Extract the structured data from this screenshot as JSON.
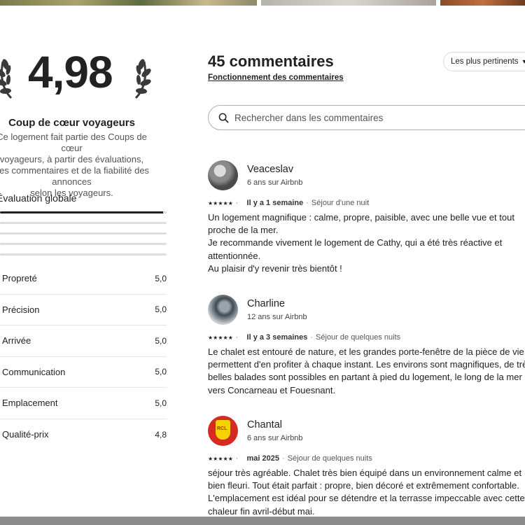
{
  "rating": {
    "value": "4,98",
    "favorite_title": "Coup de cœur voyageurs",
    "favorite_desc": "Ce logement fait partie des Coups de cœur\nvoyageurs, à partir des évaluations,\ndes commentaires et de la fiabilité des annonces\nselon les voyageurs."
  },
  "overall": {
    "label": "Évaluation globale",
    "distribution": [
      {
        "stars": 5,
        "fraction": 0.98
      },
      {
        "stars": 4,
        "fraction": 0.0
      },
      {
        "stars": 3,
        "fraction": 0.0
      },
      {
        "stars": 2,
        "fraction": 0.0
      },
      {
        "stars": 1,
        "fraction": 0.0
      }
    ]
  },
  "categories": [
    {
      "name": "Propreté",
      "score": "5,0"
    },
    {
      "name": "Précision",
      "score": "5,0"
    },
    {
      "name": "Arrivée",
      "score": "5,0"
    },
    {
      "name": "Communication",
      "score": "5,0"
    },
    {
      "name": "Emplacement",
      "score": "5,0"
    },
    {
      "name": "Qualité-prix",
      "score": "4,8"
    }
  ],
  "reviews_header": {
    "count_title": "45 commentaires",
    "how_link": "Fonctionnement des commentaires",
    "sort_label": "Les plus pertinents"
  },
  "search": {
    "placeholder": "Rechercher dans les commentaires"
  },
  "reviews": [
    {
      "name": "Veaceslav",
      "since": "6 ans sur Airbnb",
      "stars": "★★★★★",
      "when": "Il y a 1 semaine",
      "stay": "Séjour d'une nuit",
      "text": "Un logement magnifique : calme, propre, paisible, avec une belle vue et tout\nproche de la mer.\nJe recommande vivement le logement de Cathy, qui a été très réactive et\nattentionnée.\nAu plaisir d'y revenir très bientôt !"
    },
    {
      "name": "Charline",
      "since": "12 ans sur Airbnb",
      "stars": "★★★★★",
      "when": "Il y a 3 semaines",
      "stay": "Séjour de quelques nuits",
      "text": "Le chalet est entouré de nature, et les grandes porte-fenêtre de la pièce de vie\npermettent d'en profiter à chaque instant. Les environs sont magnifiques, de très\nbelles balades sont possibles en partant à pied du logement, le long de la mer\nvers Concarneau et Fouesnant."
    },
    {
      "name": "Chantal",
      "since": "6 ans sur Airbnb",
      "stars": "★★★★★",
      "when": "mai 2025",
      "stay": "Séjour de quelques nuits",
      "text": "séjour très agréable. Chalet très bien équipé dans un environnement calme et\nbien fleuri. Tout était parfait : propre, bien décoré et extrêmement confortable.\nL'emplacement est idéal pour se détendre et la terrasse impeccable avec cette\nchaleur fin avril-début mai."
    }
  ],
  "colors": {
    "text": "#222222",
    "muted": "#555555",
    "bar_track": "#dddddd",
    "bar_fill": "#222222",
    "border": "#dddddd"
  }
}
